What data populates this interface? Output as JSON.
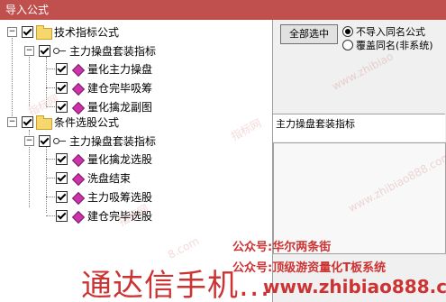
{
  "window": {
    "title": "导入公式"
  },
  "tree": {
    "groups": [
      {
        "label": "技术指标公式",
        "subgroups": [
          {
            "label": "主力操盘套装指标",
            "items": [
              "量化主力操盘",
              "建仓完毕吸筹",
              "量化擒龙副图"
            ]
          }
        ]
      },
      {
        "label": "条件选股公式",
        "subgroups": [
          {
            "label": "主力操盘套装指标",
            "items": [
              "量化擒龙选股",
              "洗盘结束",
              "主力吸筹选股",
              "建仓完毕选股"
            ]
          }
        ]
      }
    ],
    "expander_symbol": "−"
  },
  "panel": {
    "select_all_label": "全部选中",
    "radio_options": [
      {
        "label": "不导入同名公式",
        "selected": true
      },
      {
        "label": "覆盖同名(非系统)",
        "selected": false
      }
    ],
    "current_name": "主力操盘套装指标"
  },
  "watermarks": {
    "line1": "公众号:华尔两条街",
    "line2": "公众号:顶级游资量化T板系统",
    "site": "www.zhibiao888.com",
    "banner": "通达信手机...",
    "faint": [
      "指标网",
      "www.zhibiao",
      "指标网",
      "www.zhibiao888.com",
      "指标网",
      "8.com"
    ]
  },
  "colors": {
    "titlebar": "#c0504d",
    "watermark": "#cc3333"
  }
}
